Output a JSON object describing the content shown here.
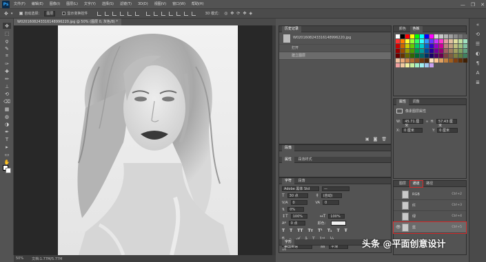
{
  "app": {
    "logo": "Ps"
  },
  "menu": [
    "文件(F)",
    "编辑(E)",
    "图像(I)",
    "图层(L)",
    "文字(Y)",
    "选择(S)",
    "滤镜(T)",
    "3D(D)",
    "视图(V)",
    "窗口(W)",
    "帮助(H)"
  ],
  "window_controls": [
    "—",
    "❐",
    "✕"
  ],
  "options": {
    "auto_select_label": "自动选择：",
    "auto_select_value": "图层",
    "show_transform": "显示变换控件",
    "mode_3d": "3D 模式："
  },
  "document": {
    "tab_title": "W0201608243316148996220.jpg @ 50% (图层 0, 灰色/8) *",
    "zoom": "50%",
    "doc_info": "文档:1.77M/5.77M"
  },
  "tools": [
    "move-tool",
    "marquee-tool",
    "lasso-tool",
    "quick-select-tool",
    "crop-tool",
    "eyedropper-tool",
    "healing-tool",
    "brush-tool",
    "stamp-tool",
    "history-brush-tool",
    "eraser-tool",
    "gradient-tool",
    "blur-tool",
    "dodge-tool",
    "pen-tool",
    "type-tool",
    "path-select-tool",
    "shape-tool",
    "hand-tool",
    "zoom-tool"
  ],
  "tool_glyphs": [
    "✥",
    "⬚",
    "ϙ",
    "✎",
    "⌗",
    "✑",
    "✚",
    "✏",
    "⊥",
    "⟲",
    "⌫",
    "▦",
    "◍",
    "◑",
    "✒",
    "T",
    "▸",
    "▭",
    "✋",
    "⚲"
  ],
  "history": {
    "tabs": [
      "历史记录"
    ],
    "snapshot": "W0201608243316148996220.jpg",
    "items": [
      "打开",
      "建立图层"
    ]
  },
  "styles_panel": {
    "tabs": [
      "段落"
    ],
    "tabs2": [
      "属性",
      "段落样式"
    ],
    "tabs3": [
      "字符",
      "段落"
    ]
  },
  "character": {
    "font": "Adobe 黑体 Std",
    "font_style": "—",
    "size": "30 点",
    "leading": "(自动)",
    "tracking": "0",
    "kerning": "0%",
    "vscale": "100%",
    "hscale": "100%",
    "baseline": "0 点",
    "color_label": "颜色：",
    "lang": "美国英语",
    "aa": "平滑",
    "footer_tab": "字形",
    "footer_value": "10"
  },
  "swatches": {
    "tabs": [
      "颜色",
      "色板"
    ],
    "colors": [
      "#ffffff",
      "#000000",
      "#ff0000",
      "#ffff00",
      "#00ff00",
      "#00ffff",
      "#0000ff",
      "#ff00ff",
      "#dcdcdc",
      "#c8c8c8",
      "#b4b4b4",
      "#a0a0a0",
      "#8c8c8c",
      "#787878",
      "#646464",
      "#ff3333",
      "#ff8000",
      "#ffff33",
      "#99ff33",
      "#33ff66",
      "#33ffff",
      "#3399ff",
      "#6633ff",
      "#cc33ff",
      "#ff33cc",
      "#e0a0a0",
      "#e0c0a0",
      "#e0e0a0",
      "#c0e0a0",
      "#a0e0c0",
      "#cc0000",
      "#cc6600",
      "#cccc00",
      "#66cc00",
      "#00cc66",
      "#00cccc",
      "#0066cc",
      "#3300cc",
      "#9900cc",
      "#cc0099",
      "#c08080",
      "#c0a080",
      "#c0c080",
      "#a0c080",
      "#80c0a0",
      "#990000",
      "#994c00",
      "#999900",
      "#4c9900",
      "#00994c",
      "#009999",
      "#004c99",
      "#260099",
      "#730099",
      "#990073",
      "#a06060",
      "#a08060",
      "#a0a060",
      "#80a060",
      "#60a080",
      "#660000",
      "#663300",
      "#666600",
      "#336600",
      "#006633",
      "#006666",
      "#003366",
      "#1a0066",
      "#4d0066",
      "#66004d",
      "#804040",
      "#806040",
      "#808040",
      "#608040",
      "#408060",
      "#f4c2a0",
      "#e8a878",
      "#d08850",
      "#b06830",
      "#905020",
      "#703810",
      "#502808",
      "#ffe0c0",
      "#ffc890",
      "#e0a060",
      "#c08040",
      "#a06020",
      "#804010",
      "#603008",
      "#402004",
      "#f0a0a0",
      "#f0c8a0",
      "#f0f0a0",
      "#c8f0a0",
      "#a0f0c8",
      "#a0f0f0",
      "#a0c8f0",
      "#c8a0f0"
    ],
    "props_tabs": [
      "属性",
      "调整"
    ],
    "props_title": "像素图层属性",
    "w_label": "W:",
    "w_value": "45.71 厘米",
    "h_label": "H:",
    "h_value": "57.43 厘米",
    "x_label": "X:",
    "x_value": "0 厘米",
    "y_label": "Y:",
    "y_value": "0 厘米",
    "link": "∞"
  },
  "layers": {
    "tabs": [
      "图层",
      "通道",
      "路径"
    ],
    "rows": [
      {
        "name": "RGB",
        "shortcut": "Ctrl+2"
      },
      {
        "name": "红",
        "shortcut": "Ctrl+3"
      },
      {
        "name": "绿",
        "shortcut": "Ctrl+4"
      },
      {
        "name": "蓝",
        "shortcut": "Ctrl+5"
      }
    ]
  },
  "watermark": "头条 @平面创意设计",
  "colors": {
    "selection_outline": "#d42a2a",
    "app_bg": "#535353",
    "canvas_bg": "#282828"
  }
}
